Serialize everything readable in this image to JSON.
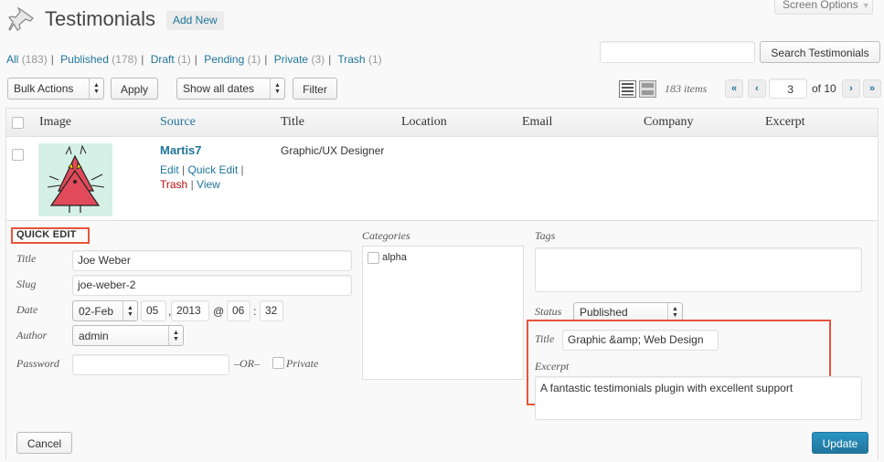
{
  "screen_options": {
    "label": "Screen Options",
    "arrow": "▼"
  },
  "header": {
    "title": "Testimonials",
    "add_new": "Add New",
    "icon": "pushpin-icon"
  },
  "filters": [
    {
      "label": "All",
      "count": "(183)"
    },
    {
      "label": "Published",
      "count": "(178)"
    },
    {
      "label": "Draft",
      "count": "(1)"
    },
    {
      "label": "Pending",
      "count": "(1)"
    },
    {
      "label": "Private",
      "count": "(3)"
    },
    {
      "label": "Trash",
      "count": "(1)"
    }
  ],
  "search": {
    "value": "",
    "button": "Search Testimonials"
  },
  "toolbar": {
    "bulk_actions": "Bulk Actions",
    "apply": "Apply",
    "dates": "Show all dates",
    "filter": "Filter"
  },
  "pagination": {
    "items": "183 items",
    "first": "«",
    "prev": "‹",
    "current_page": "3",
    "of": "of 10",
    "next": "›",
    "last": "»"
  },
  "columns": [
    "Image",
    "Source",
    "Title",
    "Location",
    "Email",
    "Company",
    "Excerpt"
  ],
  "row": {
    "source": "Martis7",
    "actions": {
      "edit": "Edit",
      "quick_edit": "Quick Edit",
      "trash": "Trash",
      "view": "View"
    },
    "title": "Graphic/UX Designer"
  },
  "quick_edit": {
    "heading": "QUICK EDIT",
    "title_label": "Title",
    "title_value": "Joe Weber",
    "slug_label": "Slug",
    "slug_value": "joe-weber-2",
    "date_label": "Date",
    "month": "02-Feb",
    "day": "05",
    "year": "2013",
    "at": "@",
    "hour": "06",
    "colon": ":",
    "minute": "32",
    "comma": ",",
    "author_label": "Author",
    "author_value": "admin",
    "password_label": "Password",
    "password_value": "",
    "or": "–OR–",
    "private_label": "Private",
    "categories_label": "Categories",
    "categories": [
      "alpha"
    ],
    "tags_label": "Tags",
    "tags_value": "",
    "status_label": "Status",
    "status_value": "Published",
    "t_title_label": "Title",
    "t_title_value": "Graphic &amp; Web Design",
    "excerpt_label": "Excerpt",
    "excerpt_value": "A fantastic testimonials plugin with excellent support",
    "cancel": "Cancel",
    "update": "Update"
  },
  "colors": {
    "link": "#21759b",
    "trash": "#bc0b0b",
    "highlight_box": "#e8533c",
    "primary_button": "#21759b"
  }
}
